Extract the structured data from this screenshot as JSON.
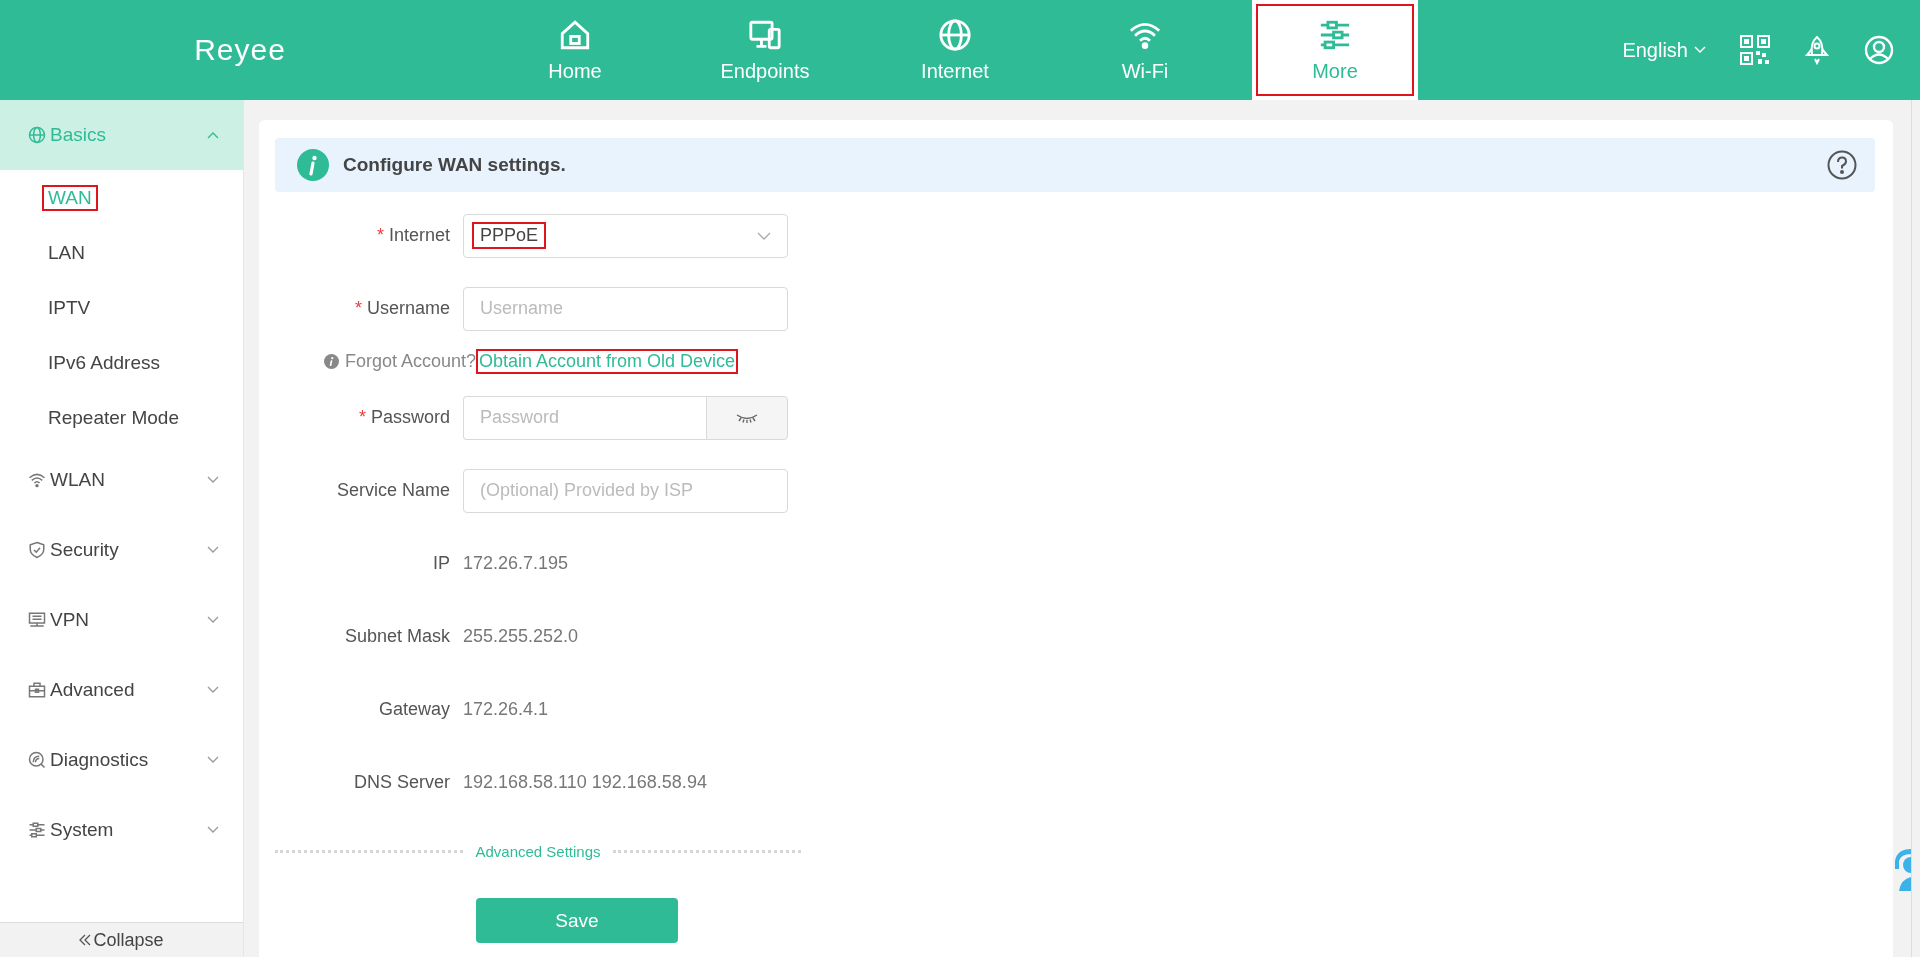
{
  "header": {
    "logo": "Reyee",
    "nav": [
      {
        "label": "Home",
        "selected": false,
        "highlighted": false
      },
      {
        "label": "Endpoints",
        "selected": false,
        "highlighted": false
      },
      {
        "label": "Internet",
        "selected": false,
        "highlighted": false
      },
      {
        "label": "Wi-Fi",
        "selected": false,
        "highlighted": false
      },
      {
        "label": "More",
        "selected": true,
        "highlighted": true
      }
    ],
    "language": "English"
  },
  "sidebar": {
    "groups": [
      {
        "label": "Basics",
        "expanded": true,
        "children": [
          {
            "label": "WAN",
            "selected": true,
            "highlighted": true
          },
          {
            "label": "LAN",
            "selected": false,
            "highlighted": false
          },
          {
            "label": "IPTV",
            "selected": false,
            "highlighted": false
          },
          {
            "label": "IPv6 Address",
            "selected": false,
            "highlighted": false
          },
          {
            "label": "Repeater Mode",
            "selected": false,
            "highlighted": false
          }
        ]
      },
      {
        "label": "WLAN",
        "expanded": false
      },
      {
        "label": "Security",
        "expanded": false
      },
      {
        "label": "VPN",
        "expanded": false
      },
      {
        "label": "Advanced",
        "expanded": false
      },
      {
        "label": "Diagnostics",
        "expanded": false
      },
      {
        "label": "System",
        "expanded": false
      }
    ],
    "collapse": "Collapse"
  },
  "banner": {
    "text": "Configure WAN settings."
  },
  "form": {
    "rows": [
      {
        "kind": "select",
        "label": "Internet",
        "mark": "*",
        "value": "PPPoE",
        "highlighted": true
      },
      {
        "kind": "input",
        "label": "Username",
        "mark": "*",
        "placeholder": "Username"
      },
      {
        "kind": "hint",
        "text": "Forgot Account?",
        "link": "Obtain Account from Old Device",
        "highlighted": true
      },
      {
        "kind": "password",
        "label": "Password",
        "mark": "*",
        "placeholder": "Password"
      },
      {
        "kind": "input",
        "label": "Service Name",
        "placeholder": "(Optional) Provided by ISP"
      },
      {
        "kind": "static",
        "label": "IP",
        "value": "172.26.7.195"
      },
      {
        "kind": "static",
        "label": "Subnet Mask",
        "value": "255.255.252.0"
      },
      {
        "kind": "static",
        "label": "Gateway",
        "value": "172.26.4.1"
      },
      {
        "kind": "static",
        "label": "DNS Server",
        "value": "192.168.58.110 192.168.58.94"
      }
    ],
    "advanced": "Advanced Settings",
    "save": "Save"
  }
}
